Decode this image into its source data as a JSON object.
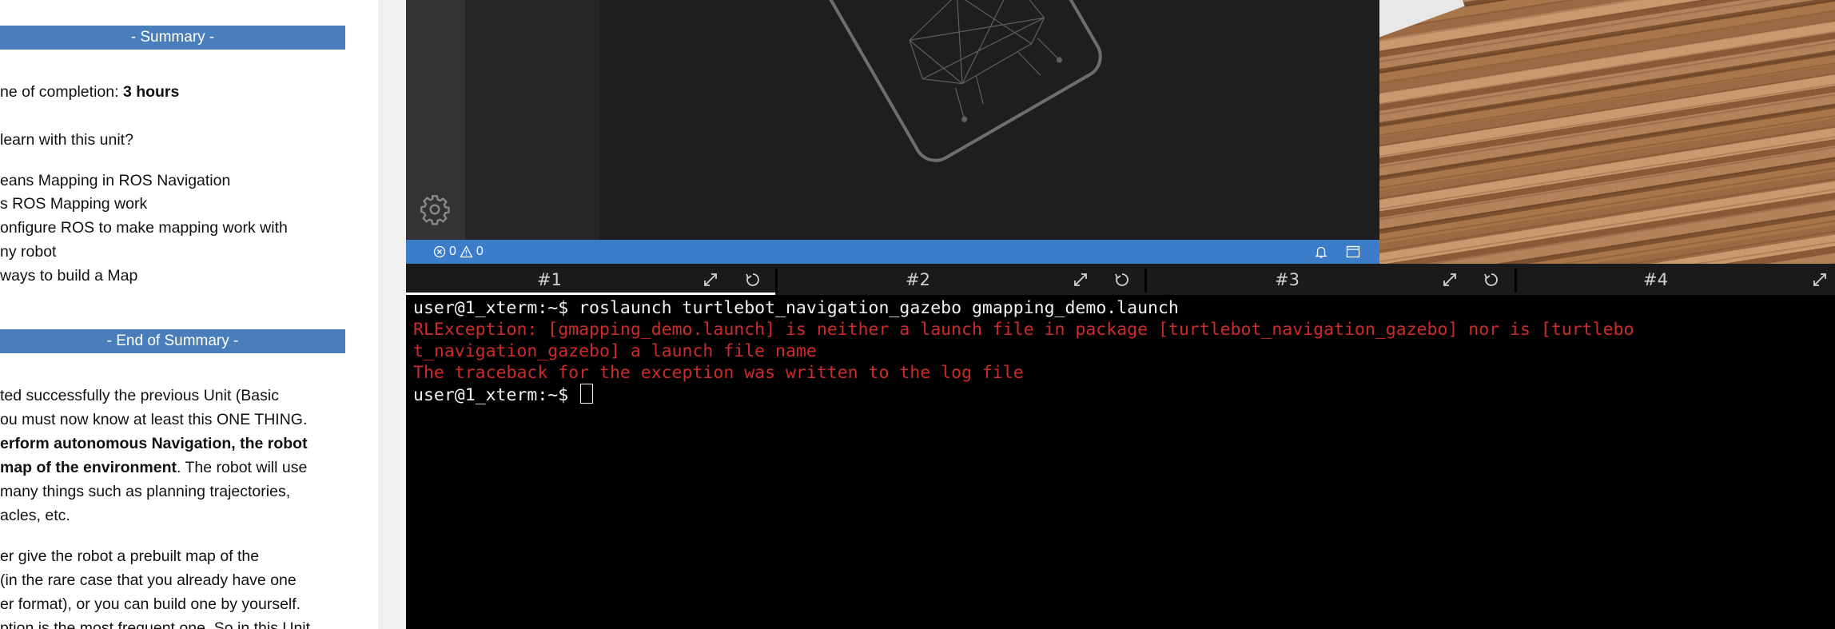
{
  "notebook": {
    "summary_banner": "- Summary -",
    "completion_prefix": "ne of completion: ",
    "completion_value": "3 hours",
    "learn_question": " learn with this unit?",
    "items": [
      "eans Mapping in ROS Navigation",
      "s ROS Mapping work",
      "onfigure ROS to make mapping work with",
      "ny robot",
      " ways to build a Map"
    ],
    "end_banner": "- End of Summary -",
    "para1_l1": "ted successfully the previous Unit (Basic",
    "para1_l2": "ou must now know at least this ONE THING.",
    "para1_l3_bold": "erform autonomous Navigation, the robot",
    "para1_l4_bold": " map of the environment",
    "para1_l4_rest": ". The robot will use",
    "para1_l5": "many things such as planning trajectories,",
    "para1_l6": "acles, etc.",
    "para2_l1": "er give the robot a prebuilt map of the",
    "para2_l2": "(in the rare case that you already have one",
    "para2_l3": "er format), or you can build one by yourself.",
    "para2_l4": "ption is the most frequent one. So in this Unit"
  },
  "ide": {
    "errors": "0",
    "warnings": "0"
  },
  "tabs": [
    {
      "label": "#1"
    },
    {
      "label": "#2"
    },
    {
      "label": "#3"
    },
    {
      "label": "#4"
    }
  ],
  "terminal": {
    "prompt1": "user@1_xterm:~$ ",
    "command": "roslaunch turtlebot_navigation_gazebo gmapping_demo.launch",
    "error_l1": "RLException: [gmapping_demo.launch] is neither a launch file in package [turtlebot_navigation_gazebo] nor is [turtlebo",
    "error_l2": "t_navigation_gazebo] a launch file name",
    "error_l3": "The traceback for the exception was written to the log file",
    "prompt2": "user@1_xterm:~$ "
  },
  "colors": {
    "banner": "#4a7ebb",
    "status_bar": "#3b7dc8",
    "terminal_error": "#cd2a2a"
  }
}
